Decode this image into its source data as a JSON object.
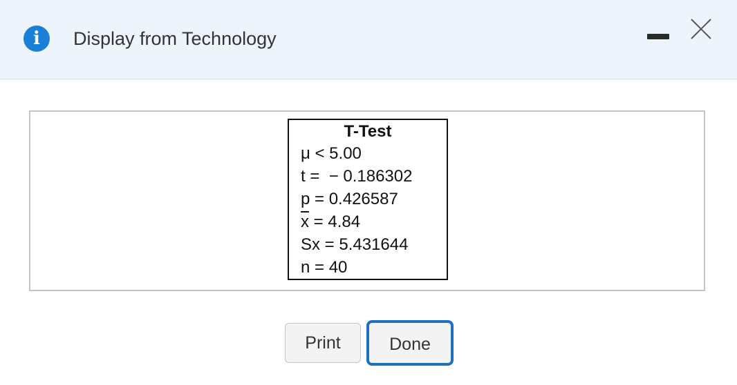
{
  "dialog": {
    "title": "Display from Technology",
    "info_icon_glyph": "i",
    "icons": {
      "info": "info-icon",
      "minimize": "minimize-icon",
      "close": "close-icon"
    },
    "accent_color": "#1a7fd6"
  },
  "result": {
    "title": "T-Test",
    "lines": [
      "μ < 5.00",
      "t =  − 0.186302",
      "p = 0.426587",
      "x = 4.84",
      "Sx = 5.431644",
      "n = 40"
    ],
    "xbar_symbol": "x",
    "xbar_value_text": " = 4.84"
  },
  "buttons": {
    "print_label": "Print",
    "done_label": "Done"
  }
}
